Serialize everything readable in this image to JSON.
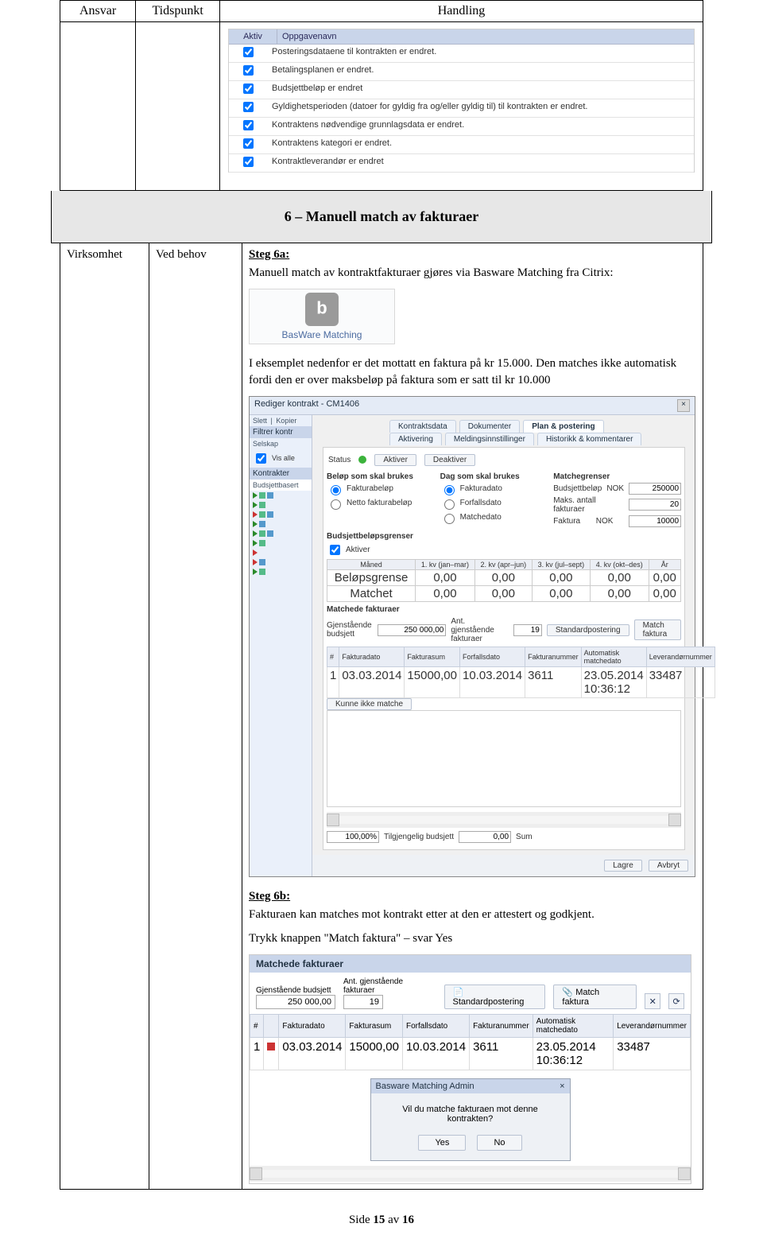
{
  "headers": {
    "c1": "Ansvar",
    "c2": "Tidspunkt",
    "c3": "Handling"
  },
  "tasklist": {
    "col_active": "Aktiv",
    "col_name": "Oppgavenavn",
    "rows": [
      "Posteringsdataene til kontrakten er endret.",
      "Betalingsplanen er endret.",
      "Budsjettbeløp er endret",
      "Gyldighetsperioden (datoer for gyldig fra og/eller gyldig til) til kontrakten er endret.",
      "Kontraktens nødvendige grunnlagsdata er endret.",
      "Kontraktens kategori er endret.",
      "Kontraktleverandør er endret"
    ]
  },
  "section_title": "6 – Manuell match av fakturaer",
  "row": {
    "ansvar": "Virksomhet",
    "tidspunkt": "Ved behov",
    "step6a_label": "Steg 6a:",
    "step6a_text": "Manuell match av kontraktfakturaer gjøres via Basware Matching fra Citrix:",
    "basware_label": "BasWare Matching",
    "p2": "I eksemplet nedenfor er det mottatt en faktura på kr 15.000. Den matches ikke automatisk fordi den er over maksbeløp på faktura som er satt til kr 10.000",
    "step6b_label": "Steg 6b:",
    "step6b_text": "Fakturaen kan matches mot kontrakt etter at den er attestert og godkjent.",
    "step6b_text2": "Trykk knappen \"Match faktura\" – svar Yes"
  },
  "dlg": {
    "title": "Rediger kontrakt - CM1406",
    "tabs_top": [
      "Kontraktsdata",
      "Dokumenter",
      "Plan & postering"
    ],
    "tabs_bot": [
      "Aktivering",
      "Meldingsinnstillinger",
      "Historikk & kommentarer"
    ],
    "side": {
      "slett": "Slett",
      "kopier": "Kopier",
      "filtrer": "Filtrer kontr",
      "selskap": "Selskap",
      "vis_alle": "Vis alle",
      "kontrakter": "Kontrakter",
      "budsjett": "Budsjettbasert"
    },
    "status_label": "Status",
    "btn_aktiver": "Aktiver",
    "btn_deaktiver": "Deaktiver",
    "sec_belop": "Beløp som skal brukes",
    "sec_dag": "Dag som skal brukes",
    "sec_matche": "Matchegrenser",
    "radios": {
      "fakturabelop": "Fakturabeløp",
      "netto": "Netto fakturabeløp",
      "fakturadato": "Fakturadato",
      "forfallsdato": "Forfallsdato",
      "matchedato": "Matchedato"
    },
    "limits": {
      "budsjett": {
        "label": "Budsjettbeløp",
        "cur": "NOK",
        "val": "250000"
      },
      "maks": {
        "label": "Maks. antall fakturaer",
        "val": "20"
      },
      "faktura": {
        "label": "Faktura",
        "cur": "NOK",
        "val": "10000"
      }
    },
    "sec_budgrenser": "Budsjettbeløpsgrenser",
    "aktiver_cb": "Aktiver",
    "q_headers": [
      "Måned",
      "1. kv (jan–mar)",
      "2. kv (apr–jun)",
      "3. kv (jul–sept)",
      "4. kv (okt–des)",
      "År"
    ],
    "q_rows": [
      {
        "label": "Beløpsgrense",
        "v": [
          "0,00",
          "0,00",
          "0,00",
          "0,00",
          "0,00",
          "0,00"
        ]
      },
      {
        "label": "Matchet",
        "v": [
          "0,00",
          "0,00",
          "0,00",
          "0,00",
          "0,00",
          "0,00"
        ]
      }
    ],
    "sec_matchede": "Matchede fakturaer",
    "gjen_label": "Gjenstående budsjett",
    "gjen_val": "250 000,00",
    "ant_label": "Ant. gjenstående fakturaer",
    "ant_val": "19",
    "std_btn": "Standardpostering",
    "match_btn": "Match faktura",
    "fcols": [
      "#",
      "Fakturadato",
      "Fakturasum",
      "Forfallsdato",
      "Fakturanummer",
      "Automatisk matchedato",
      "Leverandørnummer"
    ],
    "frow": [
      "1",
      "03.03.2014",
      "15000,00",
      "10.03.2014",
      "3611",
      "23.05.2014 10:36:12",
      "33487"
    ],
    "kunne": "Kunne ikke matche",
    "progress": "100,00%",
    "tilg": "Tilgjengelig budsjett",
    "tilg_val": "0,00",
    "sum": "Sum",
    "lagre": "Lagre",
    "avbryt": "Avbryt"
  },
  "panel2": {
    "title": "Matchede fakturaer",
    "gjen_label": "Gjenstående budsjett",
    "gjen_val": "250 000,00",
    "ant_label": "Ant. gjenstående fakturaer",
    "ant_val": "19",
    "std_btn": "Standardpostering",
    "match_btn": "Match faktura",
    "fcols": [
      "#",
      "",
      "Fakturadato",
      "Fakturasum",
      "Forfallsdato",
      "Fakturanummer",
      "Automatisk matchedato",
      "Leverandørnummer"
    ],
    "frow": [
      "1",
      "",
      "03.03.2014",
      "15000,00",
      "10.03.2014",
      "3611",
      "23.05.2014 10:36:12",
      "33487"
    ]
  },
  "confirm": {
    "title": "Basware Matching Admin",
    "msg": "Vil du matche fakturaen mot denne kontrakten?",
    "yes": "Yes",
    "no": "No"
  },
  "footer": {
    "pre": "Side ",
    "n": "15",
    "mid": " av ",
    "tot": "16"
  }
}
